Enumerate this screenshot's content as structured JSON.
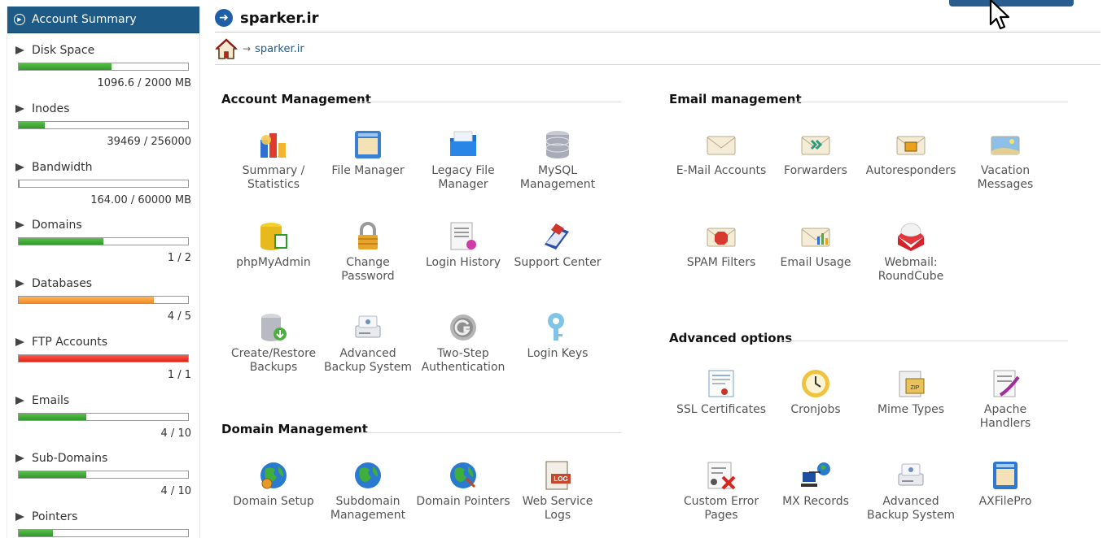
{
  "sidebar": {
    "header": "Account Summary",
    "stats": [
      {
        "label": "Disk Space",
        "value": "1096.6 / 2000 MB",
        "fraction": 0.548,
        "color": "green"
      },
      {
        "label": "Inodes",
        "value": "39469 / 256000",
        "fraction": 0.154,
        "color": "green"
      },
      {
        "label": "Bandwidth",
        "value": "164.00 / 60000 MB",
        "fraction": 0.003,
        "color": "green"
      },
      {
        "label": "Domains",
        "value": "1 / 2",
        "fraction": 0.5,
        "color": "green"
      },
      {
        "label": "Databases",
        "value": "4 / 5",
        "fraction": 0.8,
        "color": "orange"
      },
      {
        "label": "FTP Accounts",
        "value": "1 / 1",
        "fraction": 1.0,
        "color": "red"
      },
      {
        "label": "Emails",
        "value": "4 / 10",
        "fraction": 0.4,
        "color": "green"
      },
      {
        "label": "Sub-Domains",
        "value": "4 / 10",
        "fraction": 0.4,
        "color": "green"
      },
      {
        "label": "Pointers",
        "value": "",
        "fraction": 0.2,
        "color": "green"
      }
    ]
  },
  "header": {
    "title": "sparker.ir",
    "breadcrumb": "sparker.ir"
  },
  "sections": {
    "account": {
      "title": "Account Management",
      "items": [
        {
          "label": "Summary /\nStatistics",
          "icon": "chart-icon"
        },
        {
          "label": "File Manager",
          "icon": "file-manager-icon"
        },
        {
          "label": "Legacy File\nManager",
          "icon": "folder-icon"
        },
        {
          "label": "MySQL\nManagement",
          "icon": "database-icon"
        },
        {
          "label": "phpMyAdmin",
          "icon": "phpmyadmin-icon"
        },
        {
          "label": "Change\nPassword",
          "icon": "lock-icon"
        },
        {
          "label": "Login History",
          "icon": "login-history-icon"
        },
        {
          "label": "Support Center",
          "icon": "support-icon"
        },
        {
          "label": "Create/Restore\nBackups",
          "icon": "backup-icon"
        },
        {
          "label": "Advanced\nBackup System",
          "icon": "drive-icon"
        },
        {
          "label": "Two-Step\nAuthentication",
          "icon": "two-step-icon"
        },
        {
          "label": "Login Keys",
          "icon": "key-icon"
        }
      ]
    },
    "domain": {
      "title": "Domain Management",
      "items": [
        {
          "label": "Domain Setup",
          "icon": "globe-gear-icon"
        },
        {
          "label": "Subdomain\nManagement",
          "icon": "globe-icon"
        },
        {
          "label": "Domain Pointers",
          "icon": "globe-pointer-icon"
        },
        {
          "label": "Web Service\nLogs",
          "icon": "log-icon"
        }
      ]
    },
    "email": {
      "title": "Email management",
      "items": [
        {
          "label": "E-Mail Accounts",
          "icon": "envelope-icon"
        },
        {
          "label": "Forwarders",
          "icon": "forward-envelope-icon"
        },
        {
          "label": "Autoresponders",
          "icon": "autoresponder-icon"
        },
        {
          "label": "Vacation\nMessages",
          "icon": "vacation-icon"
        },
        {
          "label": "SPAM Filters",
          "icon": "spam-icon"
        },
        {
          "label": "Email Usage",
          "icon": "email-usage-icon"
        },
        {
          "label": "Webmail:\nRoundCube",
          "icon": "roundcube-icon"
        }
      ]
    },
    "advanced": {
      "title": "Advanced options",
      "items": [
        {
          "label": "SSL Certificates",
          "icon": "certificate-icon"
        },
        {
          "label": "Cronjobs",
          "icon": "clock-icon"
        },
        {
          "label": "Mime Types",
          "icon": "mime-icon"
        },
        {
          "label": "Apache Handlers",
          "icon": "apache-icon"
        },
        {
          "label": "Custom Error\nPages",
          "icon": "error-page-icon"
        },
        {
          "label": "MX Records",
          "icon": "mx-icon"
        },
        {
          "label": "Advanced\nBackup System",
          "icon": "drive-icon"
        },
        {
          "label": "AXFilePro",
          "icon": "axfilepro-icon"
        }
      ]
    }
  }
}
